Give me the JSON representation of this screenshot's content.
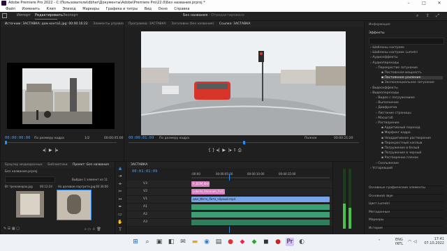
{
  "window": {
    "title": "Adobe Premiere Pro 2022 - C:\\Пользователи\\dbher\\Документы\\Adobe\\Premiere Pro\\22.0\\Без названия.prproj *"
  },
  "menu": [
    "Файл",
    "Изменить",
    "Клип",
    "Эпизод",
    "Маркеры",
    "Графика и титры",
    "Вид",
    "Окно",
    "Справка"
  ],
  "workspace": {
    "tabs": [
      "Импорт",
      "Редактировать",
      "Экспорт"
    ],
    "active": "Редактировать",
    "project_name": "Без названия",
    "status": "- Отредактировано"
  },
  "source_panel": {
    "tabs": [
      "Источник: ЗАСТАВКА: дом конта1.jpg: 00:00:16:22",
      "Элементы управления"
    ],
    "timecode": "00:00:00:00",
    "fit": "По размеру кадра",
    "scale": "1/2",
    "duration": "00:00:05:00"
  },
  "program_panel": {
    "tabs": [
      "Программа: ЗАСТАВКА",
      "Заголовки (без названия)",
      "Ссылка: ЗАСТАВКА"
    ],
    "timecode": "00:00:01:09",
    "fit": "По размеру кадра",
    "quality": "Полное",
    "duration": "00:00:21:20"
  },
  "project_panel": {
    "tabs": [
      "Браузер медиаданных",
      "Библиотеки",
      "Проект: Без названия"
    ],
    "file": "Без названия.prproj",
    "selection": "Выбран 1 элемент из 11",
    "items": [
      {
        "name": "Вт тренажерах.jpg",
        "duration": "00:12:24"
      },
      {
        "name": "На деловом портрете.jpg",
        "duration": "00:30:00"
      }
    ]
  },
  "timeline": {
    "tab": "ЗАСТАВКА",
    "timecode": "00:01:01:09",
    "ruler": [
      ":00:00",
      "00:00:05:00",
      "00:00:10:00",
      "00:00:15:00"
    ],
    "tracks": {
      "video": [
        "V3",
        "V2",
        "V1"
      ],
      "audio": [
        "A1",
        "A2",
        "A3"
      ]
    },
    "clips": [
      {
        "label": "Р_ДОМ_Фото",
        "track": "V3"
      },
      {
        "label": "Lobelia_Panoram_Ful1_00.jpg",
        "track": "V2"
      },
      {
        "label": "дом_Фото_Лето_чёрный.mp4",
        "track": "V1"
      }
    ]
  },
  "effects_panel": {
    "tabs": [
      "Информация",
      "Эффекты"
    ],
    "items": [
      {
        "label": "Шаблоны настроек",
        "level": 0
      },
      {
        "label": "Шаблоны настроек Lumetri",
        "level": 0
      },
      {
        "label": "Аудиоэффекты",
        "level": 0
      },
      {
        "label": "Аудиопереходы",
        "level": 0
      },
      {
        "label": "Перекрестие затухание",
        "level": 1
      },
      {
        "label": "Постоянная мощность",
        "level": 2
      },
      {
        "label": "Постоянное усиление",
        "level": 2,
        "selected": true
      },
      {
        "label": "Экспоненциальное затухание",
        "level": 2
      },
      {
        "label": "Видеоэффекты",
        "level": 0
      },
      {
        "label": "Видеопереходы",
        "level": 0
      },
      {
        "label": "Видео с погружением",
        "level": 1
      },
      {
        "label": "Выполнение",
        "level": 1
      },
      {
        "label": "Диафрагма",
        "level": 1
      },
      {
        "label": "Листание страницы",
        "level": 1
      },
      {
        "label": "Масштаб",
        "level": 1
      },
      {
        "label": "Растворение",
        "level": 1
      },
      {
        "label": "Аддитивный переход",
        "level": 2
      },
      {
        "label": "Морфинг кадра",
        "level": 2
      },
      {
        "label": "Неаддитивное растворение",
        "level": 2
      },
      {
        "label": "Перекрестный наплыв",
        "level": 2
      },
      {
        "label": "Погружение в белый",
        "level": 2
      },
      {
        "label": "Погружение в черный",
        "level": 2
      },
      {
        "label": "Растворение пленок",
        "level": 2
      },
      {
        "label": "Скольжение",
        "level": 1
      },
      {
        "label": "Устаревший",
        "level": 0
      }
    ],
    "bottom": [
      "Основные графические элементы",
      "Основной звук",
      "Цвет Lumetri",
      "Метаданные",
      "Маркеры",
      "История"
    ]
  },
  "taskbar": {
    "lang": "ENG\nINTL",
    "time": "17:41",
    "date": "07.10.2022"
  },
  "colors": {
    "accent": "#2d8ceb",
    "v1": "#7aa4e8",
    "v2": "#d77fbf",
    "audio": "#3a9f73"
  }
}
